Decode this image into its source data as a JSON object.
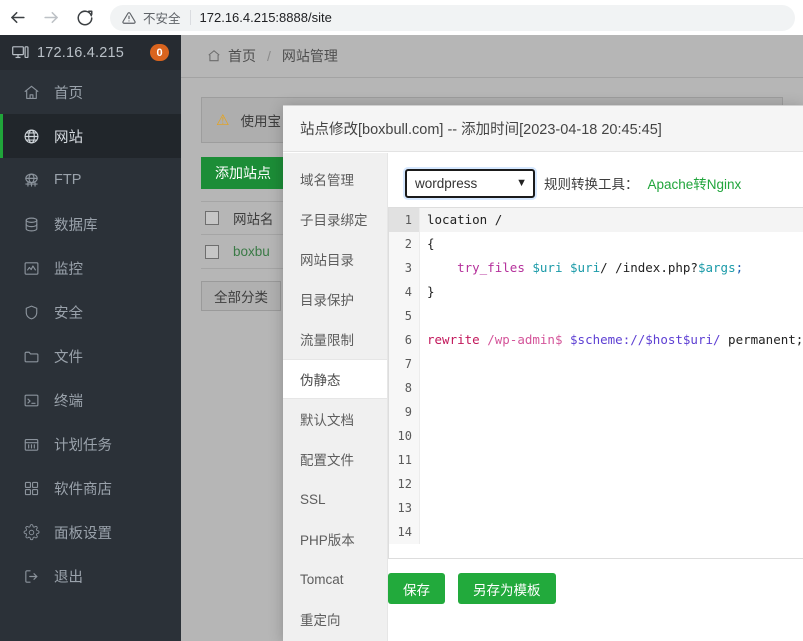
{
  "browser": {
    "back_icon": "arrow-left-icon",
    "forward_icon": "arrow-right-icon",
    "reload_icon": "reload-icon",
    "warning_icon": "warning-triangle-icon",
    "not_secure_label": "不安全",
    "url": "172.16.4.215:8888/site"
  },
  "sidebar": {
    "logo_icon": "monitor-icon",
    "ip": "172.16.4.215",
    "badge": "0",
    "items": [
      {
        "icon": "home-icon",
        "label": "首页",
        "active": false
      },
      {
        "icon": "globe-icon",
        "label": "网站",
        "active": true
      },
      {
        "icon": "ftp-icon",
        "label": "FTP",
        "active": false
      },
      {
        "icon": "database-icon",
        "label": "数据库",
        "active": false
      },
      {
        "icon": "monitor-chart-icon",
        "label": "监控",
        "active": false
      },
      {
        "icon": "shield-icon",
        "label": "安全",
        "active": false
      },
      {
        "icon": "folder-icon",
        "label": "文件",
        "active": false
      },
      {
        "icon": "terminal-icon",
        "label": "终端",
        "active": false
      },
      {
        "icon": "calendar-icon",
        "label": "计划任务",
        "active": false
      },
      {
        "icon": "apps-grid-icon",
        "label": "软件商店",
        "active": false
      },
      {
        "icon": "gear-icon",
        "label": "面板设置",
        "active": false
      },
      {
        "icon": "logout-icon",
        "label": "退出",
        "active": false
      }
    ]
  },
  "breadcrumb": {
    "home_icon": "home-icon",
    "home": "首页",
    "separator": "/",
    "current": "网站管理"
  },
  "content": {
    "notice_icon": "warning-triangle-icon",
    "notice_text": "使用宝",
    "add_site_label": "添加站点",
    "rows": [
      {
        "label": "网站名",
        "link": false
      },
      {
        "label": "boxbu",
        "link": true
      }
    ],
    "category_label": "全部分类"
  },
  "modal": {
    "title": "站点修改[boxbull.com] -- 添加时间[2023-04-18 20:45:45]",
    "tabs": [
      {
        "label": "域名管理",
        "active": false
      },
      {
        "label": "子目录绑定",
        "active": false
      },
      {
        "label": "网站目录",
        "active": false
      },
      {
        "label": "目录保护",
        "active": false
      },
      {
        "label": "流量限制",
        "active": false
      },
      {
        "label": "伪静态",
        "active": true
      },
      {
        "label": "默认文档",
        "active": false
      },
      {
        "label": "配置文件",
        "active": false
      },
      {
        "label": "SSL",
        "active": false
      },
      {
        "label": "PHP版本",
        "active": false
      },
      {
        "label": "Tomcat",
        "active": false
      },
      {
        "label": "重定向",
        "active": false
      }
    ],
    "rule_select_value": "wordpress",
    "rule_select_options": [
      "wordpress"
    ],
    "caret_icon": "chevron-down-icon",
    "rule_tool_label": "规则转换工具：",
    "rule_tool_link": "Apache转Nginx",
    "editor": {
      "lines": [
        {
          "n": "1",
          "active": true,
          "tokens": [
            {
              "t": "location /",
              "c": "tok-txt"
            }
          ]
        },
        {
          "n": "2",
          "active": false,
          "tokens": [
            {
              "t": "{",
              "c": "tok-txt"
            }
          ]
        },
        {
          "n": "3",
          "active": false,
          "tokens": [
            {
              "t": "    ",
              "c": "tok-txt"
            },
            {
              "t": "try_files",
              "c": "tok-kw"
            },
            {
              "t": " ",
              "c": "tok-txt"
            },
            {
              "t": "$uri",
              "c": "tok-var"
            },
            {
              "t": " ",
              "c": "tok-txt"
            },
            {
              "t": "$uri",
              "c": "tok-var"
            },
            {
              "t": "/ /index.php?",
              "c": "tok-txt"
            },
            {
              "t": "$args",
              "c": "tok-var"
            },
            {
              "t": ";",
              "c": "tok-pun"
            }
          ]
        },
        {
          "n": "4",
          "active": false,
          "tokens": [
            {
              "t": "}",
              "c": "tok-txt"
            }
          ]
        },
        {
          "n": "5",
          "active": false,
          "tokens": [
            {
              "t": "",
              "c": "tok-txt"
            }
          ]
        },
        {
          "n": "6",
          "active": false,
          "tokens": [
            {
              "t": "rewrite",
              "c": "tok-fn"
            },
            {
              "t": " ",
              "c": "tok-txt"
            },
            {
              "t": "/wp-admin$",
              "c": "tok-path"
            },
            {
              "t": " ",
              "c": "tok-txt"
            },
            {
              "t": "$scheme://$host$uri/",
              "c": "tok-url"
            },
            {
              "t": " permanent;",
              "c": "tok-txt"
            }
          ]
        },
        {
          "n": "7",
          "active": false,
          "tokens": [
            {
              "t": "",
              "c": "tok-txt"
            }
          ]
        },
        {
          "n": "8",
          "active": false,
          "tokens": [
            {
              "t": "",
              "c": "tok-txt"
            }
          ]
        },
        {
          "n": "9",
          "active": false,
          "tokens": [
            {
              "t": "",
              "c": "tok-txt"
            }
          ]
        },
        {
          "n": "10",
          "active": false,
          "tokens": [
            {
              "t": "",
              "c": "tok-txt"
            }
          ]
        },
        {
          "n": "11",
          "active": false,
          "tokens": [
            {
              "t": "",
              "c": "tok-txt"
            }
          ]
        },
        {
          "n": "12",
          "active": false,
          "tokens": [
            {
              "t": "",
              "c": "tok-txt"
            }
          ]
        },
        {
          "n": "13",
          "active": false,
          "tokens": [
            {
              "t": "",
              "c": "tok-txt"
            }
          ]
        },
        {
          "n": "14",
          "active": false,
          "tokens": [
            {
              "t": "",
              "c": "tok-txt"
            }
          ]
        }
      ]
    },
    "save_label": "保存",
    "save_as_template_label": "另存为模板"
  },
  "colors": {
    "accent_green": "#22aa3c",
    "sidebar_bg": "#2b3138",
    "badge_orange": "#d9641e",
    "link_green": "#21a53c"
  }
}
